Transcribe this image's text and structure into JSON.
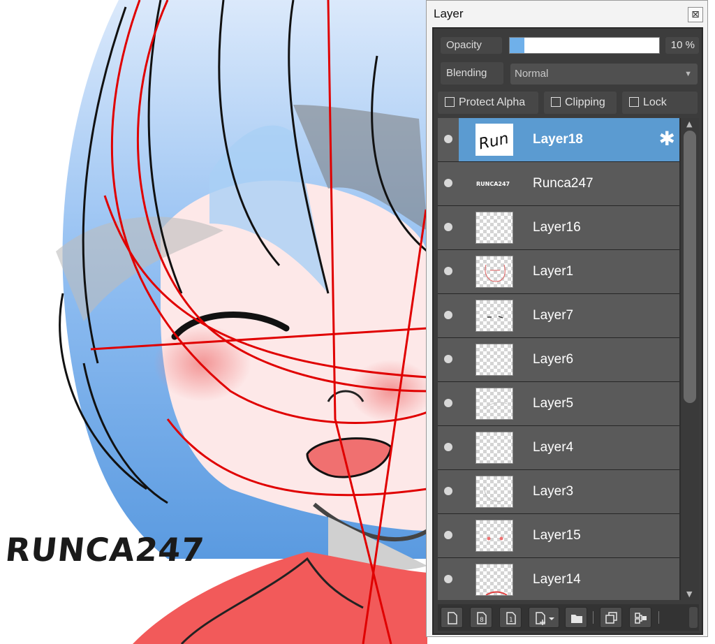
{
  "canvas": {
    "watermark": "RUNCA247"
  },
  "panel": {
    "title": "Layer",
    "close_icon": "close-icon",
    "opacity_label": "Opacity",
    "opacity_value": "10 %",
    "opacity_fraction": 0.1,
    "blending_label": "Blending",
    "blending_value": "Normal",
    "protect_alpha_label": "Protect Alpha",
    "clipping_label": "Clipping",
    "lock_label": "Lock",
    "selection_color": "#5b9bd1"
  },
  "layers": [
    {
      "name": "Layer18",
      "selected": true,
      "thumb_text": "Run"
    },
    {
      "name": "Runca247",
      "selected": false,
      "thumb_text": "RUNCA247"
    },
    {
      "name": "Layer16",
      "selected": false
    },
    {
      "name": "Layer1",
      "selected": false
    },
    {
      "name": "Layer7",
      "selected": false
    },
    {
      "name": "Layer6",
      "selected": false
    },
    {
      "name": "Layer5",
      "selected": false
    },
    {
      "name": "Layer4",
      "selected": false
    },
    {
      "name": "Layer3",
      "selected": false
    },
    {
      "name": "Layer15",
      "selected": false
    },
    {
      "name": "Layer14",
      "selected": false
    }
  ],
  "toolbar": {
    "buttons": [
      "new-layer-icon",
      "new-8bit-layer-icon",
      "new-1bit-layer-icon",
      "add-layer-menu-icon",
      "new-folder-icon",
      "duplicate-layer-icon",
      "merge-down-icon"
    ]
  }
}
